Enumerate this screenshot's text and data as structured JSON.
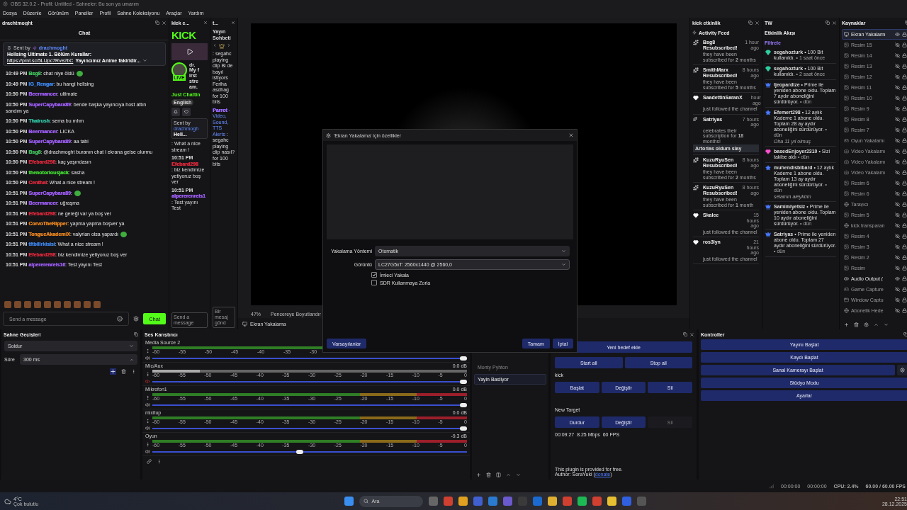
{
  "window": {
    "title": "OBS 32.0.2 - Profil: Untitled - Sahneler: Bu son ya umarım"
  },
  "menu": [
    "Dosya",
    "Düzenle",
    "Görünüm",
    "Paneller",
    "Profil",
    "Sahne Koleksiyonu",
    "Araçlar",
    "Yardım"
  ],
  "chat_dock": {
    "title": "drachtmoght",
    "heading": "Chat",
    "pinned": {
      "sent_by": "Sent by",
      "author": "drachmoght",
      "title": "Hellsing Ultimate 1. Bölüm Kurallar:",
      "link": "https://prnt.sc/5LUpc7Rve2bC",
      "text": "Yayıncımız Anime fakiridir..."
    },
    "messages": [
      {
        "time": "10:49 PM",
        "user": "Bsg8",
        "color": "#3fbf5a",
        "text": ": chat niye öldü",
        "emote": true
      },
      {
        "time": "10:49 PM",
        "user": "IG_Rengar",
        "color": "#3b7fe0",
        "text": ": bu hangi hellsing",
        "emote": false
      },
      {
        "time": "10:50 PM",
        "user": "Beermancer",
        "color": "#9b5cf0",
        "text": ": ultimate",
        "emote": false
      },
      {
        "time": "10:50 PM",
        "user": "SuperCapybara89",
        "color": "#9b5cf0",
        "text": ": bende başka yayıncıya host attın sandım ya",
        "emote": false
      },
      {
        "time": "10:50 PM",
        "user": "Thairush",
        "color": "#2fb89a",
        "text": ": sema bu mhm",
        "emote": false
      },
      {
        "time": "10:50 PM",
        "user": "Beermancer",
        "color": "#9b5cf0",
        "text": ": LICKA",
        "emote": false
      },
      {
        "time": "10:50 PM",
        "user": "SuperCapybara89",
        "color": "#9b5cf0",
        "text": ": aa tabi",
        "emote": false
      },
      {
        "time": "10:50 PM",
        "user": "Bsg8",
        "color": "#3fbf5a",
        "text": ": @drachmoght buranın chat i ekrana gelse olurmu",
        "emote": false
      },
      {
        "time": "10:50 PM",
        "user": "Efebard298",
        "color": "#d8283a",
        "text": ": kaç yaşındasın",
        "emote": false
      },
      {
        "time": "10:50 PM",
        "user": "thenotoriousjack",
        "color": "#40d030",
        "text": ": sasha",
        "emote": false
      },
      {
        "time": "10:50 PM",
        "user": "Centhal",
        "color": "#d8283a",
        "text": ": What a nice stream !",
        "emote": false
      },
      {
        "time": "10:51 PM",
        "user": "SuperCapybara89",
        "color": "#9b5cf0",
        "text": ":",
        "emote": true
      },
      {
        "time": "10:51 PM",
        "user": "Beermancer",
        "color": "#9b5cf0",
        "text": ": uğraşma",
        "emote": false
      },
      {
        "time": "10:51 PM",
        "user": "Efebard298",
        "color": "#d8283a",
        "text": ": ne gereği var ya boş ver",
        "emote": false
      },
      {
        "time": "10:51 PM",
        "user": "CorvoTheRipper",
        "color": "#e0801f",
        "text": ": yapma yapma boşver ya",
        "emote": false
      },
      {
        "time": "10:51 PM",
        "user": "TongucAkademiX",
        "color": "#e0801f",
        "text": ": valyrian olsa yapardı",
        "emote": true
      },
      {
        "time": "10:51 PM",
        "user": "tftbilirkisisi",
        "color": "#3b7fe0",
        "text": ": What a nice stream !",
        "emote": false
      },
      {
        "time": "10:51 PM",
        "user": "Efebard298",
        "color": "#d8283a",
        "text": ": biz kendimize yetiyoruz boş ver",
        "emote": false
      },
      {
        "time": "10:51 PM",
        "user": "alpererenreis16",
        "color": "#9b5cf0",
        "text": ": Test yayını Test",
        "emote": false
      }
    ],
    "input": {
      "placeholder": "Send a message"
    },
    "send": "Chat"
  },
  "kick_dock": {
    "title": "kick c...",
    "logo": "KICK",
    "live": "LIVE",
    "name": "dr.",
    "about": "My first stream.",
    "category": "Just Chattin",
    "tag": "English",
    "pinned": {
      "sent_by": "Sent by",
      "author": "drachmogh",
      "text": "Hell..."
    },
    "messages": [
      {
        "text": ": What a nice stream !"
      },
      {
        "time": "10:51 PM",
        "user": "Efebard298",
        "color": "#d8283a",
        "text": ": biz kendimize yetiyoruz boş ver"
      },
      {
        "time": "10:51 PM",
        "user": "alpererenreis1",
        "color": "#9b5cf0",
        "text": ": Test yayını Test"
      }
    ],
    "input": {
      "placeholder": "Send a message"
    }
  },
  "twitch_chat_dock": {
    "title": "t...",
    "heading": "Yayın Sohbeti",
    "messages": [
      {
        "text": ": segahc playing clip Bi de bayıl istiyors Feriha asdhag for 100 bits"
      },
      {
        "user": "Parrot",
        "color": "#9b6bff",
        "sub": "- Video, Sound, TTS Alerts",
        "text": ": segahc playing clip nasıl? for 100 bits"
      }
    ],
    "input": {
      "placeholder": "Bir mesaj gönd"
    }
  },
  "preview": {
    "zoom": "47%",
    "fit": "Pencereye Boyutlandır",
    "source": "Ekran Yakalama"
  },
  "dialog": {
    "title": "'Ekran Yakalama' için özellikler",
    "fields": [
      {
        "label": "Yakalama Yöntemi",
        "value": "Otomatik"
      },
      {
        "label": "Görüntü",
        "value": "LC27G5xT: 2560x1440 @ 2560,0"
      }
    ],
    "checks": [
      {
        "label": "İmleci Yakala",
        "checked": true
      },
      {
        "label": "SDR Kullanmaya Zorla",
        "checked": false
      }
    ],
    "defaults": "Varsayılanlar",
    "ok": "Tamam",
    "cancel": "İptal"
  },
  "kick_events": {
    "title": "kick etkinlik",
    "heading": "Activity Feed",
    "events": [
      {
        "kind": "resub",
        "user": "Bsg8",
        "action": "Resubscribed!",
        "time": "1 hour ago",
        "detail": "they have been subscribed for **2** months"
      },
      {
        "kind": "resub",
        "user": "SmithMarx",
        "action": "Resubscribed!",
        "time": "8 hours ago",
        "detail": "they have been subscribed for **5** months"
      },
      {
        "kind": "follow",
        "user": "SaadettinSaranX",
        "time": "hour ago",
        "detail": "just followed the channel"
      },
      {
        "kind": "sub",
        "user": "Satriyas",
        "time": "7 hours ago",
        "detail": "celebrates their subscription for **18** months!",
        "message": "Artorias oldum slay"
      },
      {
        "kind": "resub",
        "user": "KuzuRyuSen",
        "action": "Resubscribed!",
        "time": "8 hours ago",
        "detail": "they have been subscribed for **2** months"
      },
      {
        "kind": "resub",
        "user": "KuzuRyuSen",
        "action": "Resubscribed!",
        "time": "8 hours ago",
        "detail": "they have been subscribed for **1** month"
      },
      {
        "kind": "follow",
        "user": "Skalee",
        "time": "15 hours ago",
        "detail": "just followed the channel"
      },
      {
        "kind": "follow",
        "user": "ros3lyn",
        "time": "21 hours ago",
        "detail": "just followed the channel"
      }
    ]
  },
  "twitch_events": {
    "title": "TW",
    "heading": "Etkinlik Akışı",
    "filter": "Filtrele",
    "events": [
      {
        "kind": "bits",
        "user": "segahozturk",
        "text": "• 100 Bit kullanıldı.",
        "time": "• 1 saat önce"
      },
      {
        "kind": "bits",
        "user": "segahozturk",
        "text": "• 100 Bit kullanıldı.",
        "time": "• 2 saat önce"
      },
      {
        "kind": "prime",
        "user": "Ijeopardize",
        "text": "• Prime ile yeniden abone oldu. Toplam 7 aydır aboneliğini sürdürüyor.",
        "time": "• dün"
      },
      {
        "kind": "sub",
        "user": "Efemert298",
        "text": "• 12 aylık Kademe 1 abone oldu. Toplam 28 ay aydır aboneliğini sürdürüyor.",
        "time": "• dün",
        "message": "Oha 11 yıl olmuş"
      },
      {
        "kind": "follow",
        "user": "basedEnjoyer2310",
        "text": "• Sizi takibe aldı",
        "time": "• dün"
      },
      {
        "kind": "sub",
        "user": "muhendisbibard",
        "text": "• 12 aylık Kademe 1 abone oldu. Toplam 13 ay aydır aboneliğini sürdürüyor.",
        "time": "• dün",
        "message": "selamın aleyküm"
      },
      {
        "kind": "prime",
        "user": "Samimiyetsiz",
        "text": "• Prime ile yeniden abone oldu. Toplam 10 aydır aboneliğini sürdürüyor.",
        "time": "• dün"
      },
      {
        "kind": "prime",
        "user": "Satriyas",
        "text": "• Prime ile yeniden abone oldu. Toplam 27 aydır aboneliğini sürdürüyor.",
        "time": "• dün"
      }
    ]
  },
  "sources": {
    "title": "Kaynaklar",
    "items": [
      {
        "kind": "display",
        "name": "Ekran Yakalamı",
        "visible": true,
        "selected": true
      },
      {
        "kind": "image",
        "name": "Resim 15",
        "visible": false,
        "selected": false
      },
      {
        "kind": "image",
        "name": "Resim 14",
        "visible": false,
        "selected": false
      },
      {
        "kind": "image",
        "name": "Resim 13",
        "visible": false,
        "selected": false
      },
      {
        "kind": "image",
        "name": "Resim 12",
        "visible": false,
        "selected": false
      },
      {
        "kind": "image",
        "name": "Resim 11",
        "visible": false,
        "selected": false
      },
      {
        "kind": "image",
        "name": "Resim 10",
        "visible": false,
        "selected": false
      },
      {
        "kind": "image",
        "name": "Resim 9",
        "visible": false,
        "selected": false
      },
      {
        "kind": "image",
        "name": "Resim 8",
        "visible": false,
        "selected": false
      },
      {
        "kind": "image",
        "name": "Resim 7",
        "visible": false,
        "selected": false
      },
      {
        "kind": "game",
        "name": "Oyun Yakalamı",
        "visible": false,
        "selected": false
      },
      {
        "kind": "camera",
        "name": "Video Yakalamı",
        "visible": false,
        "selected": false
      },
      {
        "kind": "camera",
        "name": "Video Yakalamı",
        "visible": false,
        "selected": false
      },
      {
        "kind": "camera",
        "name": "Video Yakalamı",
        "visible": false,
        "selected": false
      },
      {
        "kind": "image",
        "name": "Resim 6",
        "visible": false,
        "selected": false
      },
      {
        "kind": "image",
        "name": "Resim 6",
        "visible": false,
        "selected": false
      },
      {
        "kind": "browser",
        "name": "Tarayıcı",
        "visible": false,
        "selected": false
      },
      {
        "kind": "image",
        "name": "Resim 5",
        "visible": false,
        "selected": false
      },
      {
        "kind": "browser",
        "name": "kick transparan",
        "visible": false,
        "selected": false
      },
      {
        "kind": "image",
        "name": "Resim 4",
        "visible": false,
        "selected": false
      },
      {
        "kind": "image",
        "name": "Resim 3",
        "visible": false,
        "selected": false
      },
      {
        "kind": "image",
        "name": "Resim 2",
        "visible": false,
        "selected": false
      },
      {
        "kind": "image",
        "name": "Resim",
        "visible": false,
        "selected": false
      },
      {
        "kind": "audio",
        "name": "Audio Output (",
        "visible": true,
        "selected": false
      },
      {
        "kind": "game",
        "name": "Game Capture",
        "visible": false,
        "selected": false
      },
      {
        "kind": "window",
        "name": "Window Captu",
        "visible": false,
        "selected": false
      },
      {
        "kind": "browser",
        "name": "Abonelik Hede",
        "visible": false,
        "selected": false
      }
    ]
  },
  "transitions": {
    "title": "Sahne Geçişleri",
    "type": "Soldur",
    "duration_label": "Süre",
    "duration": "300 ms"
  },
  "mixer": {
    "title": "Ses Karıştırıcı",
    "channels": [
      {
        "name": "Media Source 2",
        "muted": false,
        "level": 1.0,
        "scale": [
          "-60",
          "-55",
          "-50",
          "-45",
          "-40",
          "-35",
          "-30"
        ]
      },
      {
        "name": "Mic/Aux",
        "reading": "0.0 dB",
        "muted": true,
        "level": 1.0,
        "scale": [
          "-60",
          "-55",
          "-50",
          "-45",
          "-40",
          "-35",
          "-30",
          "-25",
          "-20",
          "-15",
          "-10",
          "-5",
          "0"
        ]
      },
      {
        "name": "Mikrofon1",
        "reading": "0.0 dB",
        "muted": false,
        "level": 1.0,
        "scale": [
          "-60",
          "-55",
          "-50",
          "-45",
          "-40",
          "-35",
          "-30",
          "-25",
          "-20",
          "-15",
          "-10",
          "-5",
          "0"
        ]
      },
      {
        "name": "mixitup",
        "reading": "0.0 dB",
        "muted": false,
        "level": 1.0,
        "scale": [
          "-60",
          "-55",
          "-50",
          "-45",
          "-40",
          "-35",
          "-30",
          "-25",
          "-20",
          "-15",
          "-10",
          "-5",
          "0"
        ]
      },
      {
        "name": "Oyun",
        "reading": "-9.3 dB",
        "muted": false,
        "level": 0.48,
        "scale": [
          "-60",
          "-55",
          "-50",
          "-45",
          "-40",
          "-35",
          "-30",
          "-25",
          "-20",
          "-15",
          "-10",
          "-5",
          "0"
        ]
      }
    ]
  },
  "scenes": {
    "items": [
      {
        "name": "Monty Pyhton",
        "selected": false
      },
      {
        "name": "Yayin Basliyor",
        "selected": true
      }
    ]
  },
  "multistream": {
    "add": "Yeni hedef ekle",
    "start_all": "Start all",
    "stop_all": "Stop all",
    "targets": [
      {
        "name": "kick",
        "buttons": [
          {
            "label": "Başlat",
            "disabled": false
          },
          {
            "label": "Değiştir",
            "disabled": false
          },
          {
            "label": "Sil",
            "disabled": false
          }
        ]
      },
      {
        "name": "New Target",
        "buttons": [
          {
            "label": "Durdur",
            "disabled": false
          },
          {
            "label": "Değiştir",
            "disabled": false
          },
          {
            "label": "Sil",
            "disabled": true
          }
        ],
        "stats": "00:09:27  8.25 Mbps  60 FPS"
      }
    ],
    "note": "This plugin is provided for free.",
    "author": "Author: SoraYuki (",
    "link": "donate",
    "author_end": ")"
  },
  "controls": {
    "title": "Kontroller",
    "buttons": [
      "Yayını Başlat",
      "Kaydı Başlat",
      "Sanal Kamerayı Başlat",
      "Stüdyo Modu",
      "Ayarlar"
    ]
  },
  "status_bar": {
    "stream_time": "00:00:00",
    "record_time": "00:00:00",
    "cpu": "CPU: 2.4%",
    "fps": "60.00 / 60.00 FPS"
  },
  "taskbar": {
    "temperature": "4°C",
    "weather": "Çok bulutlu",
    "search": "Ara",
    "time": "22:51",
    "date": "28.12.2025"
  }
}
